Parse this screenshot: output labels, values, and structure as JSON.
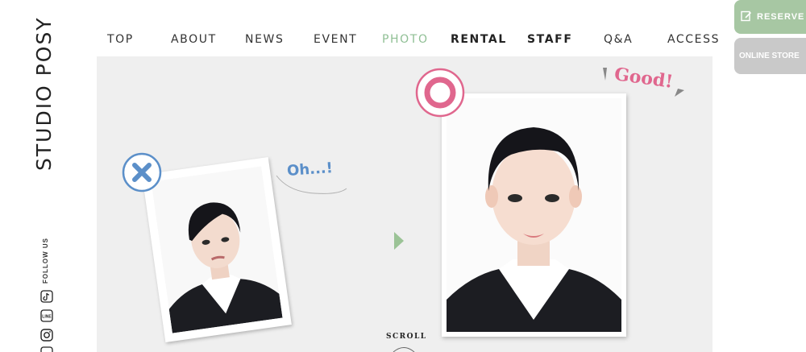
{
  "brand": {
    "name": "STUDIO POSY"
  },
  "nav": {
    "items": [
      {
        "label": "TOP"
      },
      {
        "label": "ABOUT"
      },
      {
        "label": "NEWS"
      },
      {
        "label": "EVENT"
      },
      {
        "label": "PHOTO"
      },
      {
        "label": "RENTAL"
      },
      {
        "label": "STAFF"
      },
      {
        "label": "Q&A"
      },
      {
        "label": "ACCESS"
      }
    ],
    "active": "PHOTO",
    "active_color": "#8fbf94"
  },
  "side_buttons": {
    "reserve_label": "RESERVE",
    "reserve_icon": "edit-icon",
    "reserve_color": "#a7c7a3",
    "store_label": "ONLINE STORE",
    "store_color": "#c9c9c9"
  },
  "social": {
    "follow_label": "FOLLOW US",
    "icons": [
      "tiktok-icon",
      "line-icon",
      "instagram-icon"
    ],
    "line_text": "LINE"
  },
  "main": {
    "bad_caption": "Oh...!",
    "good_caption": "Good!",
    "bad_color": "#5b8fc9",
    "good_color": "#e0678e",
    "scroll_label": "SCROLL"
  }
}
